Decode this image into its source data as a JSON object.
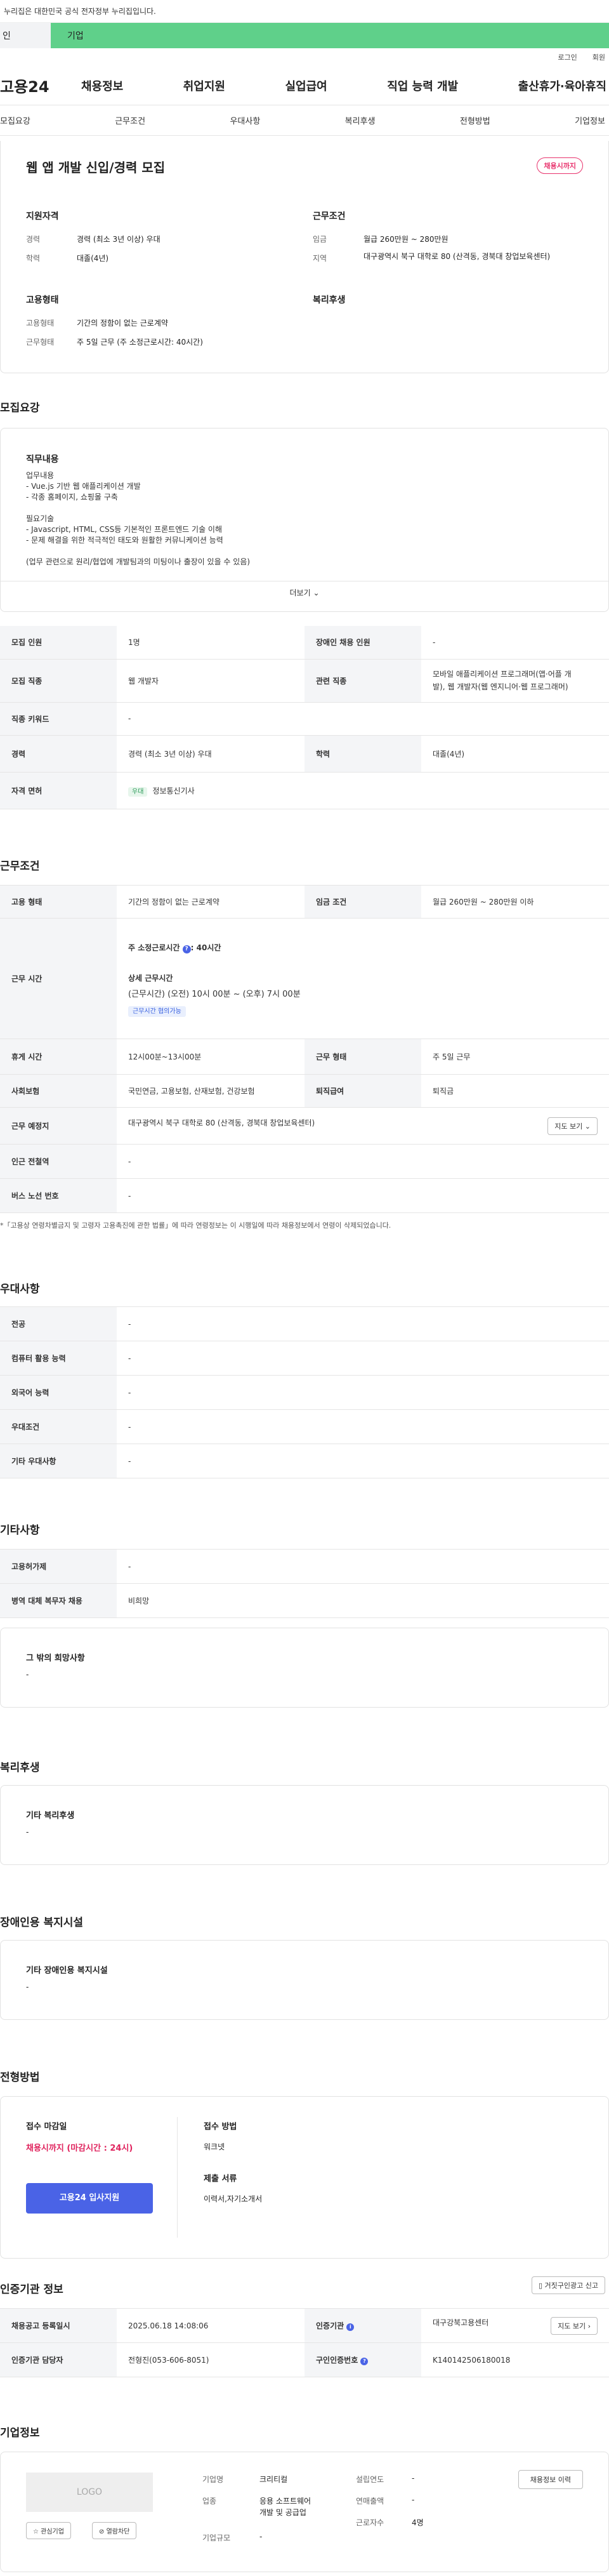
{
  "notice": "누리집은 대한민국 공식 전자정부 누리집입니다.",
  "tabs": {
    "individual": "인",
    "company": "기업"
  },
  "utility": {
    "login": "로그인",
    "signup": "회원"
  },
  "gnb": {
    "logo": "고용24",
    "items": [
      "채용정보",
      "취업지원",
      "실업급여",
      "직업 능력 개발",
      "출산휴가·육아휴직"
    ]
  },
  "subnav": [
    "모집요강",
    "근무조건",
    "우대사항",
    "복리후생",
    "전형방법",
    "기업정보"
  ],
  "summary": {
    "title": "웹 앱 개발 신입/경력 모집",
    "status_badge": "채용시까지",
    "qual_heading": "지원자격",
    "cond_heading": "근무조건",
    "qual": [
      {
        "k": "경력",
        "v": "경력 (최소 3년 이상) 우대"
      },
      {
        "k": "학력",
        "v": "대졸(4년)"
      }
    ],
    "cond": [
      {
        "k": "임금",
        "v": "월급 260만원 ~ 280만원"
      },
      {
        "k": "지역",
        "v": "대구광역시 북구 대학로 80 (산격동, 경북대 창업보육센터)"
      }
    ],
    "emp_heading": "고용형태",
    "welfare_heading": "복리후생",
    "emp": [
      {
        "k": "고용형태",
        "v": "기간의 정함이 없는 근로계약"
      },
      {
        "k": "근무형태",
        "v": "주 5일 근무 (주 소정근로시간: 40시간)"
      }
    ]
  },
  "recruit": {
    "section_title": "모집요강",
    "duty_heading": "직무내용",
    "lines": [
      "업무내용",
      "- Vue.js 기반 웹 애플리케이션 개발",
      "- 각종 홈페이지, 쇼핑몰 구축",
      "",
      "필요기술",
      "- Javascript, HTML, CSS등 기본적인 프론트엔드 기술 이해",
      "- 문제 해결을 위한 적극적인 태도와 원활한 커뮤니케이션 능력",
      "",
      "(업무 관련으로 원리/협업에 개발팀과의 미팅이나 출장이 있을 수 있음)"
    ],
    "more_label": "더보기",
    "r1": {
      "k1": "모집 인원",
      "v1": "1명",
      "k2": "장애인 채용 인원",
      "v2": "-"
    },
    "r2": {
      "k1": "모집 직종",
      "v1": "웹 개발자",
      "k2": "관련 직종",
      "v2a": "모바일 애플리케이션 프로그래머(앱·어플 개",
      "v2b": "발), 웹 개발자(웹 엔지니어·웹 프로그래머)"
    },
    "r3": {
      "k1": "직종 키워드",
      "v1": "-"
    },
    "r4": {
      "k1": "경력",
      "v1": "경력 (최소 3년 이상) 우대",
      "k2": "학력",
      "v2": "대졸(4년)"
    },
    "r5": {
      "k1": "자격 면허",
      "tag": "우대",
      "v1": "정보통신기사"
    }
  },
  "conditions": {
    "section_title": "근무조건",
    "r1": {
      "k1": "고용 형태",
      "v1": "기간의 정함이 없는 근로계약",
      "k2": "임금 조건",
      "v2": "월급 260만원 ~ 280만원 이하"
    },
    "hours": {
      "k": "근무 시간",
      "weekly_label": "주 소정근로시간",
      "weekly_value": ": 40시간",
      "detail_label": "상세 근무시간",
      "detail_value": "(근무시간) (오전) 10시 00분 ~ (오후) 7시 00분",
      "tag": "근무시간 협의가능"
    },
    "r3": {
      "k1": "휴게 시간",
      "v1": "12시00분~13시00분",
      "k2": "근무 형태",
      "v2": "주 5일 근무"
    },
    "r4": {
      "k1": "사회보험",
      "v1": "국민연금, 고용보험, 산재보험, 건강보험",
      "k2": "퇴직급여",
      "v2": "퇴직금"
    },
    "r5": {
      "k1": "근무 예정지",
      "v1": "대구광역시 북구 대학로 80 (산격동, 경북대 창업보육센터)",
      "btn": "지도 보기"
    },
    "r6": {
      "k1": "인근 전철역",
      "v1": "-"
    },
    "r7": {
      "k1": "버스 노선 번호",
      "v1": "-"
    },
    "footnote": "*「고용상 연령차별금지 및 고령자 고용촉진에 관한 법률」에 따라 연령정보는 이 시행일에 따라 채용정보에서 연령이 삭제되었습니다."
  },
  "pref": {
    "section_title": "우대사항",
    "rows": [
      {
        "k": "전공",
        "v": "-"
      },
      {
        "k": "컴퓨터 활용 능력",
        "v": "-"
      },
      {
        "k": "외국어 능력",
        "v": "-"
      },
      {
        "k": "우대조건",
        "v": "-"
      },
      {
        "k": "기타 우대사항",
        "v": "-"
      }
    ]
  },
  "etc": {
    "section_title": "기타사항",
    "rows": [
      {
        "k": "고용허가제",
        "v": "-"
      },
      {
        "k": "병역 대체 복무자 채용",
        "v": "비희망"
      }
    ],
    "box_title": "그 밖의 희망사항",
    "box_value": "-"
  },
  "welfare": {
    "section_title": "복리후생",
    "box_title": "기타 복리후생",
    "box_value": "-"
  },
  "disabled": {
    "section_title": "장애인용 복지시설",
    "box_title": "기타 장애인용 복지시설",
    "box_value": "-"
  },
  "process": {
    "section_title": "전형방법",
    "deadline_label": "접수 마감일",
    "deadline_value": "채용시까지 (마감시간 : 24시)",
    "apply_button": "고용24 입사지원",
    "method_label": "접수 방법",
    "method_value": "워크넷",
    "docs_label": "제출 서류",
    "docs_value": "이력서,자기소개서"
  },
  "auth": {
    "section_title": "인증기관 정보",
    "report_button": "거짓구인광고 신고",
    "r1": {
      "k1": "채용공고 등록일시",
      "v1": "2025.06.18 14:08:06",
      "k2": "인증기관",
      "v2": "대구강북고용센터",
      "btn": "지도 보기"
    },
    "r2": {
      "k1": "인증기관 담당자",
      "v1": "전형진(053-606-8051)",
      "k2": "구인인증번호",
      "v2": "K140142506180018"
    }
  },
  "company": {
    "section_title": "기업정보",
    "logo_text": "LOGO",
    "fav_button": "관심기업",
    "block_button": "열람차단",
    "info_button": "채용정보 이력",
    "f_name_k": "기업명",
    "f_name_v": "크리티컬",
    "f_ind_k": "업종",
    "f_ind_v1": "응용 소프트웨어",
    "f_ind_v2": "개발 및 공급업",
    "f_size_k": "기업규모",
    "f_size_v": "-",
    "f_year_k": "설립연도",
    "f_year_v": "-",
    "f_rev_k": "연매출액",
    "f_rev_v": "-",
    "f_emp_k": "근로자수",
    "f_emp_v": "4명"
  }
}
